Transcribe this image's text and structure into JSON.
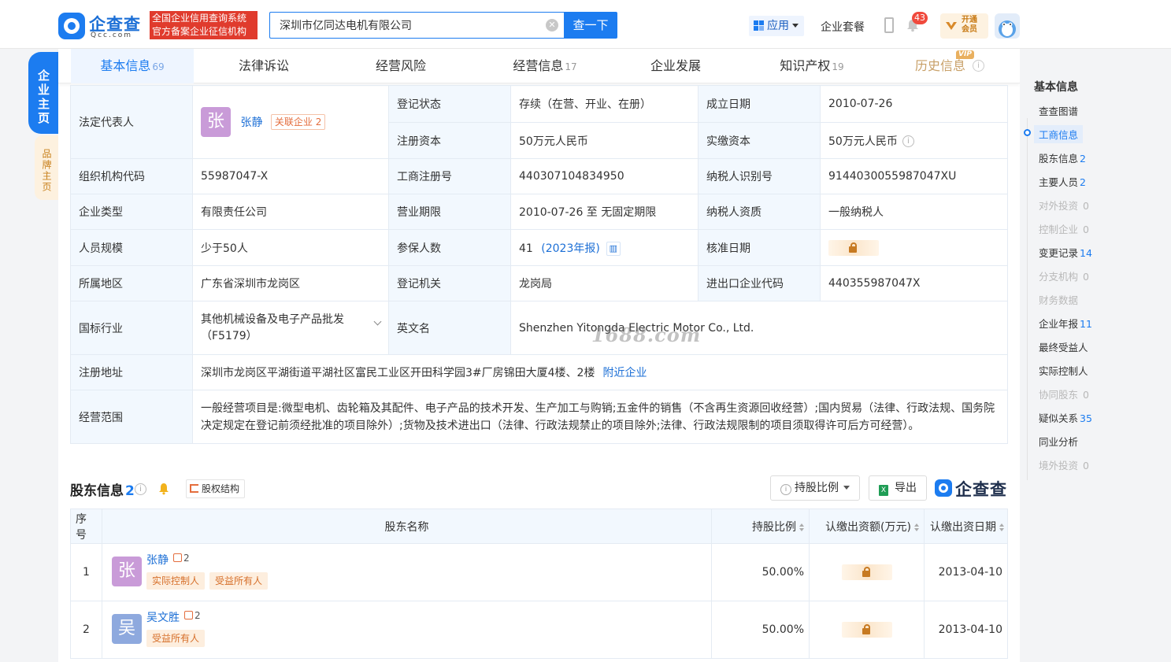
{
  "header": {
    "logo_name": "企查查",
    "logo_domain": "Qcc.com",
    "slogan_line1": "全国企业信用查询系统",
    "slogan_line2": "官方备案企业征信机构",
    "search_value": "深圳市亿同达电机有限公司",
    "search_button": "查一下",
    "app_label": "应用",
    "package_label": "企业套餐",
    "notification_count": "43",
    "vip_line1": "开通",
    "vip_line2": "会员"
  },
  "side_tabs": {
    "main": "企业主页",
    "brand": "品牌主页"
  },
  "tabs": [
    {
      "label": "基本信息",
      "count": "69"
    },
    {
      "label": "法律诉讼",
      "count": ""
    },
    {
      "label": "经营风险",
      "count": ""
    },
    {
      "label": "经营信息",
      "count": "17"
    },
    {
      "label": "企业发展",
      "count": ""
    },
    {
      "label": "知识产权",
      "count": "19"
    },
    {
      "label": "历史信息",
      "count": ""
    }
  ],
  "tab_vip_badge": "VIP",
  "info": {
    "legal_rep_label": "法定代表人",
    "legal_rep_avatar": "张",
    "legal_rep_name": "张静",
    "legal_rep_related": "关联企业",
    "legal_rep_related_count": "2",
    "reg_status_label": "登记状态",
    "reg_status_value": "存续（在营、开业、在册）",
    "founded_label": "成立日期",
    "founded_value": "2010-07-26",
    "reg_capital_label": "注册资本",
    "reg_capital_value": "50万元人民币",
    "paid_capital_label": "实缴资本",
    "paid_capital_value": "50万元人民币",
    "org_code_label": "组织机构代码",
    "org_code_value": "55987047-X",
    "biz_reg_no_label": "工商注册号",
    "biz_reg_no_value": "440307104834950",
    "taxpayer_id_label": "纳税人识别号",
    "taxpayer_id_value": "9144030055987047XU",
    "company_type_label": "企业类型",
    "company_type_value": "有限责任公司",
    "biz_term_label": "营业期限",
    "biz_term_value": "2010-07-26 至 无固定期限",
    "taxpayer_qual_label": "纳税人资质",
    "taxpayer_qual_value": "一般纳税人",
    "staff_size_label": "人员规模",
    "staff_size_value": "少于50人",
    "insured_label": "参保人数",
    "insured_value": "41",
    "insured_year": "(2023年报)",
    "approval_date_label": "核准日期",
    "region_label": "所属地区",
    "region_value": "广东省深圳市龙岗区",
    "reg_authority_label": "登记机关",
    "reg_authority_value": "龙岗局",
    "import_export_label": "进出口企业代码",
    "import_export_value": "440355987047X",
    "industry_label": "国标行业",
    "industry_value": "其他机械设备及电子产品批发（F5179）",
    "english_name_label": "英文名",
    "english_name_value": "Shenzhen Yitongda Electric Motor Co., Ltd.",
    "address_label": "注册地址",
    "address_value": "深圳市龙岗区平湖街道平湖社区富民工业区开田科学园3#厂房锦田大厦4楼、2楼",
    "nearby_link": "附近企业",
    "scope_label": "经营范围",
    "scope_value": "一般经营项目是:微型电机、齿轮箱及其配件、电子产品的技术开发、生产加工与购销;五金件的销售（不含再生资源回收经营）;国内贸易（法律、行政法规、国务院决定规定在登记前须经批准的项目除外）;货物及技术进出口（法律、行政法规禁止的项目除外;法律、行政法规限制的项目须取得许可后方可经营）。",
    "watermark": "1688.com"
  },
  "shareholders": {
    "title": "股东信息",
    "count": "2",
    "equity_button": "股权结构",
    "holding_button": "持股比例",
    "export_button": "导出",
    "logo_text": "企查查",
    "columns": [
      "序号",
      "股东名称",
      "持股比例",
      "认缴出资额(万元)",
      "认缴出资日期"
    ],
    "rows": [
      {
        "index": "1",
        "avatar": "张",
        "name": "张静",
        "related_count": "2",
        "tags": [
          "实际控制人",
          "受益所有人"
        ],
        "ratio": "50.00%",
        "date": "2013-04-10"
      },
      {
        "index": "2",
        "avatar": "吴",
        "name": "吴文胜",
        "related_count": "2",
        "tags": [
          "受益所有人"
        ],
        "ratio": "50.00%",
        "date": "2013-04-10"
      }
    ]
  },
  "right_nav": {
    "title": "基本信息",
    "items": [
      {
        "label": "查查图谱",
        "count": "",
        "state": "normal"
      },
      {
        "label": "工商信息",
        "count": "",
        "state": "active"
      },
      {
        "label": "股东信息",
        "count": "2",
        "state": "normal"
      },
      {
        "label": "主要人员",
        "count": "2",
        "state": "normal"
      },
      {
        "label": "对外投资",
        "count": "0",
        "state": "dim"
      },
      {
        "label": "控制企业",
        "count": "0",
        "state": "dim"
      },
      {
        "label": "变更记录",
        "count": "14",
        "state": "normal"
      },
      {
        "label": "分支机构",
        "count": "0",
        "state": "dim"
      },
      {
        "label": "财务数据",
        "count": "",
        "state": "dim"
      },
      {
        "label": "企业年报",
        "count": "11",
        "state": "normal"
      },
      {
        "label": "最终受益人",
        "count": "",
        "state": "normal"
      },
      {
        "label": "实际控制人",
        "count": "",
        "state": "normal"
      },
      {
        "label": "协同股东",
        "count": "0",
        "state": "dim"
      },
      {
        "label": "疑似关系",
        "count": "35",
        "state": "normal"
      },
      {
        "label": "同业分析",
        "count": "",
        "state": "normal"
      },
      {
        "label": "境外投资",
        "count": "0",
        "state": "dim"
      }
    ]
  },
  "colors": {
    "brand_blue": "#1c7cf0",
    "slogan_red": "#e03b2d",
    "label_bg": "#f2f8fe",
    "tag_orange": "#d66f2a"
  }
}
